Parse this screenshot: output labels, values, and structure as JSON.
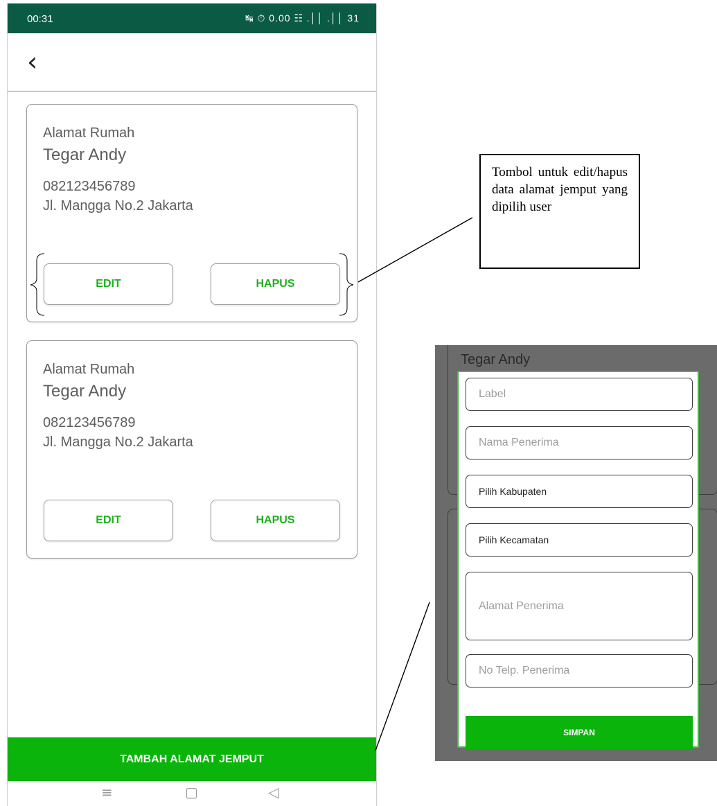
{
  "status_bar": {
    "time": "00:31",
    "icons": "↹ ⏱ 0.00 ☷ .││ .││ 31"
  },
  "app_bar": {
    "back_icon": "‹"
  },
  "address_cards": [
    {
      "label": "Alamat Rumah",
      "name": "Tegar Andy",
      "phone": "082123456789",
      "address": "Jl. Mangga No.2 Jakarta",
      "edit_label": "EDIT",
      "delete_label": "HAPUS"
    },
    {
      "label": "Alamat Rumah",
      "name": "Tegar Andy",
      "phone": "082123456789",
      "address": "Jl. Mangga No.2 Jakarta",
      "edit_label": "EDIT",
      "delete_label": "HAPUS"
    }
  ],
  "bottom_button": "TAMBAH ALAMAT JEMPUT",
  "nav_bar": {
    "menu_icon": "≡",
    "home_icon": "▢",
    "back_icon": "◁"
  },
  "annotation": "Tombol untuk edit/hapus data alamat jemput yang dipilih user",
  "dialog": {
    "background_name": "Tegar Andy",
    "label_placeholder": "Label",
    "recipient_name_placeholder": "Nama Penerima",
    "regency_select": "Pilih Kabupaten",
    "district_select": "Pilih Kecamatan",
    "address_placeholder": "Alamat Penerima",
    "phone_placeholder": "No Telp. Penerima",
    "save_label": "SIMPAN"
  },
  "colors": {
    "status_bar": "#0b5a44",
    "accent_green": "#0ab40a",
    "button_text_green": "#1fb01f",
    "dialog_border": "#49b649"
  }
}
